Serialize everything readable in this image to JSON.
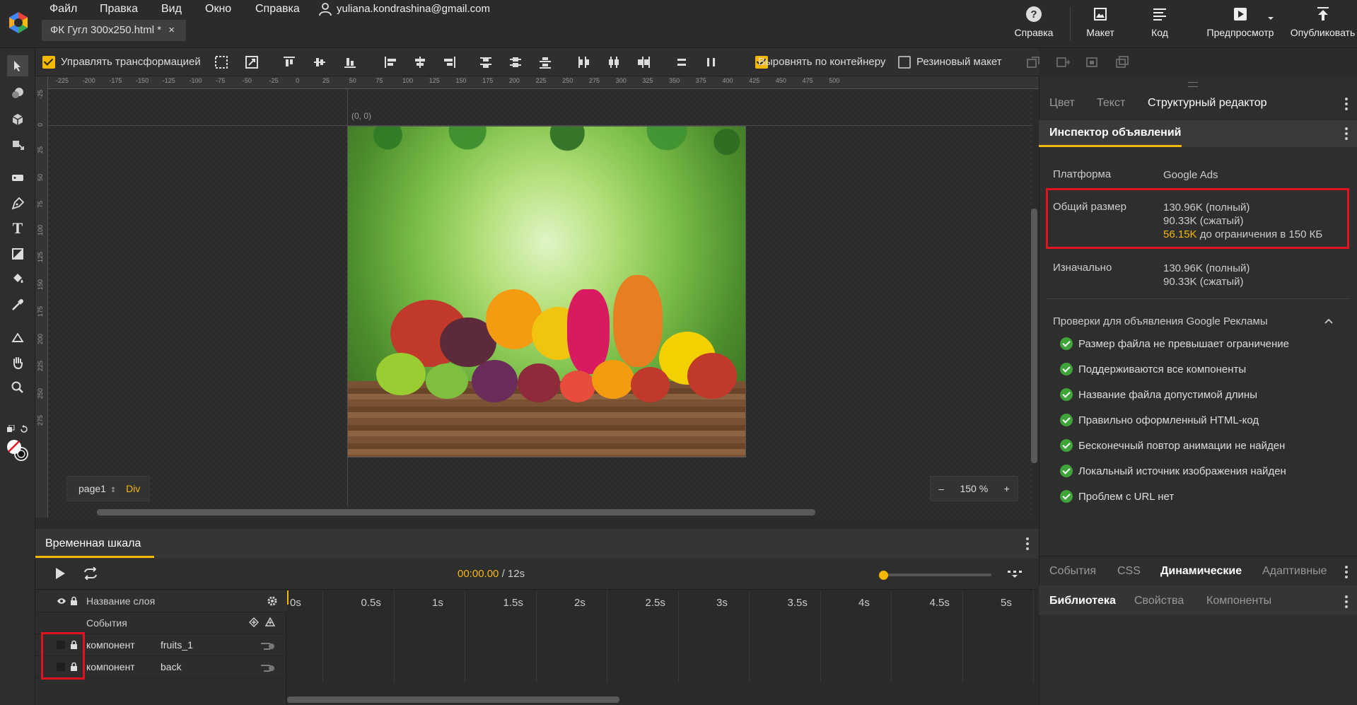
{
  "menu": {
    "file": "Файл",
    "edit": "Правка",
    "view": "Вид",
    "window": "Окно",
    "help": "Справка",
    "user": "yuliana.kondrashina@gmail.com"
  },
  "document_tab": {
    "label": "ФК Гугл 300x250.html *",
    "close": "×"
  },
  "top_buttons": {
    "help": "Справка",
    "layout": "Макет",
    "code": "Код",
    "preview": "Предпросмотр",
    "publish": "Опубликовать"
  },
  "toolbar": {
    "transform_label": "Управлять трансформацией",
    "transform_checked": true,
    "align_container_label": "Выровнять по контейнеру",
    "align_container_checked": true,
    "responsive_label": "Резиновый макет",
    "responsive_checked": false
  },
  "ruler": {
    "top_ticks": [
      "-225",
      "-200",
      "-175",
      "-150",
      "-125",
      "-100",
      "-75",
      "-50",
      "-25",
      "0",
      "25",
      "50",
      "75",
      "100",
      "125",
      "150",
      "175",
      "200",
      "225",
      "250",
      "275",
      "300",
      "325",
      "350",
      "375",
      "400",
      "425",
      "450",
      "475",
      "500"
    ],
    "left_ticks": [
      "-25",
      "0",
      "25",
      "50",
      "75",
      "100",
      "125",
      "150",
      "175",
      "200",
      "225",
      "250",
      "275"
    ]
  },
  "stage": {
    "origin": "(0, 0)",
    "page": "page1",
    "element": "Div",
    "zoom_minus": "–",
    "zoom_value": "150",
    "zoom_unit": "%",
    "zoom_plus": "+"
  },
  "right_panel": {
    "top_tabs": [
      "Цвет",
      "Текст",
      "Структурный редактор"
    ],
    "inspector_tab": "Инспектор объявлений",
    "platform_label": "Платформа",
    "platform_value": "Google Ads",
    "size_label": "Общий размер",
    "size_full": "130.96K (полный)",
    "size_compressed": "90.33K (сжатый)",
    "size_remaining_value": "56.15K",
    "size_remaining_text": "до ограничения в 150 КБ",
    "initial_label": "Изначально",
    "initial_full": "130.96K (полный)",
    "initial_compressed": "90.33K (сжатый)",
    "checks_title": "Проверки для объявления Google Рекламы",
    "checks": [
      "Размер файла не превышает ограничение",
      "Поддерживаются все компоненты",
      "Название файла допустимой длины",
      "Правильно оформленный HTML-код",
      "Бесконечный повтор анимации не найден",
      "Локальный источник изображения найден",
      "Проблем с URL нет"
    ],
    "bottom_tabs1": [
      "События",
      "CSS",
      "Динамические",
      "Адаптивные"
    ],
    "bottom_tabs2": [
      "Библиотека",
      "Свойства",
      "Компоненты"
    ]
  },
  "timeline": {
    "title": "Временная шкала",
    "current_time": "00:00.00",
    "total_time": "/ 12s",
    "layer_header": "Название слоя",
    "events_label": "События",
    "ticks": [
      "0s",
      "0.5s",
      "1s",
      "1.5s",
      "2s",
      "2.5s",
      "3s",
      "3.5s",
      "4s",
      "4.5s",
      "5s"
    ],
    "layers": [
      {
        "type": "компонент",
        "name": "fruits_1"
      },
      {
        "type": "компонент",
        "name": "back"
      }
    ]
  },
  "colors": {
    "accent": "#f5b800",
    "highlight_box": "#e0141e",
    "check_ok": "#3fa33a"
  }
}
